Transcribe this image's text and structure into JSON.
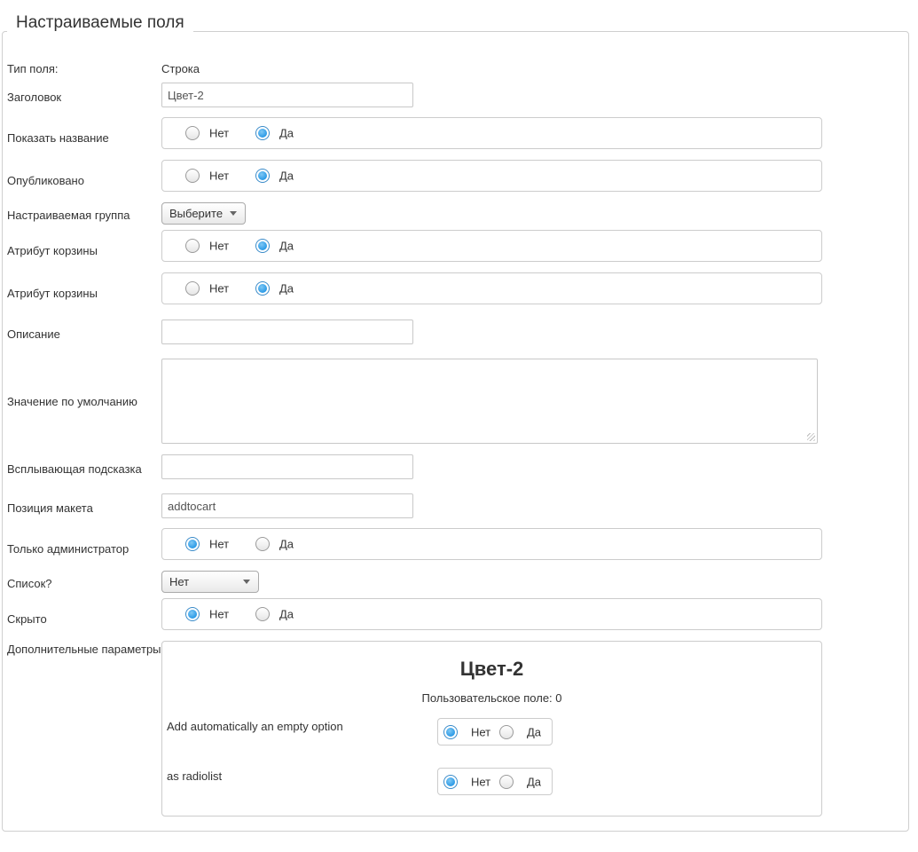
{
  "section_title": "Настраиваемые поля",
  "yes_label": "Да",
  "no_label": "Нет",
  "field_type": {
    "label": "Тип поля:",
    "value": "Строка"
  },
  "title_field": {
    "label": "Заголовок",
    "value": "Цвет-2"
  },
  "show_title": {
    "label": "Показать название",
    "selected": "Да"
  },
  "published": {
    "label": "Опубликовано",
    "selected": "Да"
  },
  "custom_group": {
    "label": "Настраиваемая группа",
    "selected": "Выберите"
  },
  "cart_attribute_1": {
    "label": "Атрибут корзины",
    "selected": "Да"
  },
  "cart_attribute_2": {
    "label": "Атрибут корзины",
    "selected": "Да"
  },
  "description": {
    "label": "Описание",
    "value": ""
  },
  "default_value": {
    "label": "Значение по умолчанию",
    "value": ""
  },
  "tooltip": {
    "label": "Всплывающая подсказка",
    "value": ""
  },
  "layout_position": {
    "label": "Позиция макета",
    "value": "addtocart"
  },
  "admin_only": {
    "label": "Только администратор",
    "selected": "Нет"
  },
  "is_list": {
    "label": "Список?",
    "selected": "Нет"
  },
  "hidden": {
    "label": "Скрыто",
    "selected": "Нет"
  },
  "extra_params": {
    "label": "Дополнительные параметры",
    "title": "Цвет-2",
    "subtitle": "Пользовательское поле: 0",
    "empty_option": {
      "label": "Add automatically an empty option",
      "selected": "Нет"
    },
    "as_radiolist": {
      "label": "as radiolist",
      "selected": "Нет"
    }
  }
}
